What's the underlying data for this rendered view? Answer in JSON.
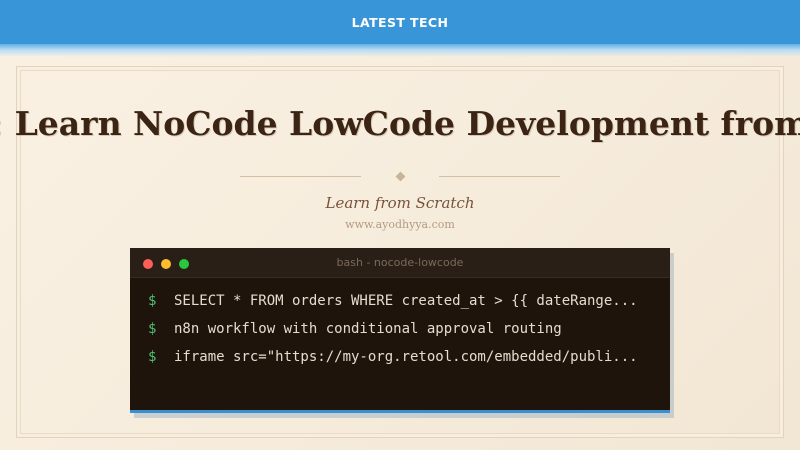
{
  "top_bar": {
    "title": "LATEST TECH"
  },
  "article": {
    "headline": ": Learn NoCode LowCode Development from",
    "subtitle": "Learn from Scratch",
    "site": "www.ayodhyya.com"
  },
  "terminal": {
    "title": "bash - nocode-lowcode",
    "prompt": "$",
    "lines": [
      "SELECT * FROM orders WHERE created_at > {{ dateRange...",
      "n8n workflow with conditional approval routing",
      "iframe src=\"https://my-org.retool.com/embedded/publi..."
    ]
  },
  "colors": {
    "top_bar": "#3896d8",
    "headline": "#3b2414",
    "terminal_bg": "#1e140c",
    "prompt": "#4cc26e",
    "accent_border": "#3a8fd0"
  },
  "icons": [
    "close-dot-icon",
    "minimize-dot-icon",
    "maximize-dot-icon",
    "divider-diamond-icon"
  ]
}
